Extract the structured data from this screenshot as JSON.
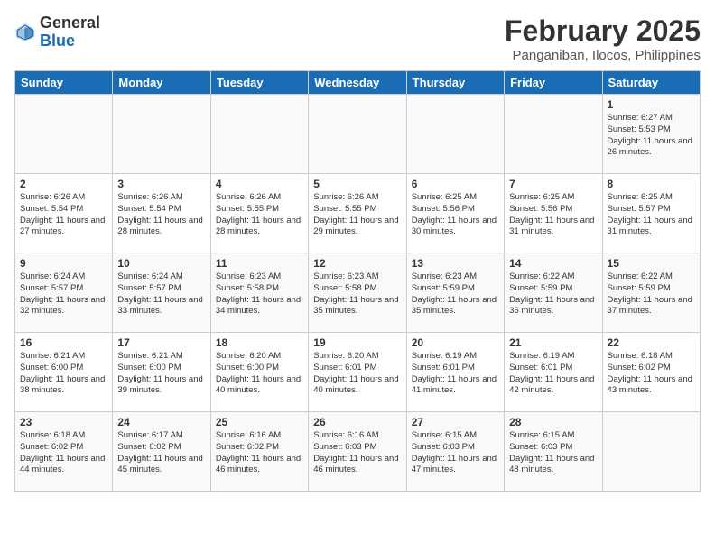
{
  "header": {
    "logo_general": "General",
    "logo_blue": "Blue",
    "month_year": "February 2025",
    "location": "Panganiban, Ilocos, Philippines"
  },
  "days_of_week": [
    "Sunday",
    "Monday",
    "Tuesday",
    "Wednesday",
    "Thursday",
    "Friday",
    "Saturday"
  ],
  "weeks": [
    [
      {
        "day": "",
        "info": ""
      },
      {
        "day": "",
        "info": ""
      },
      {
        "day": "",
        "info": ""
      },
      {
        "day": "",
        "info": ""
      },
      {
        "day": "",
        "info": ""
      },
      {
        "day": "",
        "info": ""
      },
      {
        "day": "1",
        "info": "Sunrise: 6:27 AM\nSunset: 5:53 PM\nDaylight: 11 hours and 26 minutes."
      }
    ],
    [
      {
        "day": "2",
        "info": "Sunrise: 6:26 AM\nSunset: 5:54 PM\nDaylight: 11 hours and 27 minutes."
      },
      {
        "day": "3",
        "info": "Sunrise: 6:26 AM\nSunset: 5:54 PM\nDaylight: 11 hours and 28 minutes."
      },
      {
        "day": "4",
        "info": "Sunrise: 6:26 AM\nSunset: 5:55 PM\nDaylight: 11 hours and 28 minutes."
      },
      {
        "day": "5",
        "info": "Sunrise: 6:26 AM\nSunset: 5:55 PM\nDaylight: 11 hours and 29 minutes."
      },
      {
        "day": "6",
        "info": "Sunrise: 6:25 AM\nSunset: 5:56 PM\nDaylight: 11 hours and 30 minutes."
      },
      {
        "day": "7",
        "info": "Sunrise: 6:25 AM\nSunset: 5:56 PM\nDaylight: 11 hours and 31 minutes."
      },
      {
        "day": "8",
        "info": "Sunrise: 6:25 AM\nSunset: 5:57 PM\nDaylight: 11 hours and 31 minutes."
      }
    ],
    [
      {
        "day": "9",
        "info": "Sunrise: 6:24 AM\nSunset: 5:57 PM\nDaylight: 11 hours and 32 minutes."
      },
      {
        "day": "10",
        "info": "Sunrise: 6:24 AM\nSunset: 5:57 PM\nDaylight: 11 hours and 33 minutes."
      },
      {
        "day": "11",
        "info": "Sunrise: 6:23 AM\nSunset: 5:58 PM\nDaylight: 11 hours and 34 minutes."
      },
      {
        "day": "12",
        "info": "Sunrise: 6:23 AM\nSunset: 5:58 PM\nDaylight: 11 hours and 35 minutes."
      },
      {
        "day": "13",
        "info": "Sunrise: 6:23 AM\nSunset: 5:59 PM\nDaylight: 11 hours and 35 minutes."
      },
      {
        "day": "14",
        "info": "Sunrise: 6:22 AM\nSunset: 5:59 PM\nDaylight: 11 hours and 36 minutes."
      },
      {
        "day": "15",
        "info": "Sunrise: 6:22 AM\nSunset: 5:59 PM\nDaylight: 11 hours and 37 minutes."
      }
    ],
    [
      {
        "day": "16",
        "info": "Sunrise: 6:21 AM\nSunset: 6:00 PM\nDaylight: 11 hours and 38 minutes."
      },
      {
        "day": "17",
        "info": "Sunrise: 6:21 AM\nSunset: 6:00 PM\nDaylight: 11 hours and 39 minutes."
      },
      {
        "day": "18",
        "info": "Sunrise: 6:20 AM\nSunset: 6:00 PM\nDaylight: 11 hours and 40 minutes."
      },
      {
        "day": "19",
        "info": "Sunrise: 6:20 AM\nSunset: 6:01 PM\nDaylight: 11 hours and 40 minutes."
      },
      {
        "day": "20",
        "info": "Sunrise: 6:19 AM\nSunset: 6:01 PM\nDaylight: 11 hours and 41 minutes."
      },
      {
        "day": "21",
        "info": "Sunrise: 6:19 AM\nSunset: 6:01 PM\nDaylight: 11 hours and 42 minutes."
      },
      {
        "day": "22",
        "info": "Sunrise: 6:18 AM\nSunset: 6:02 PM\nDaylight: 11 hours and 43 minutes."
      }
    ],
    [
      {
        "day": "23",
        "info": "Sunrise: 6:18 AM\nSunset: 6:02 PM\nDaylight: 11 hours and 44 minutes."
      },
      {
        "day": "24",
        "info": "Sunrise: 6:17 AM\nSunset: 6:02 PM\nDaylight: 11 hours and 45 minutes."
      },
      {
        "day": "25",
        "info": "Sunrise: 6:16 AM\nSunset: 6:02 PM\nDaylight: 11 hours and 46 minutes."
      },
      {
        "day": "26",
        "info": "Sunrise: 6:16 AM\nSunset: 6:03 PM\nDaylight: 11 hours and 46 minutes."
      },
      {
        "day": "27",
        "info": "Sunrise: 6:15 AM\nSunset: 6:03 PM\nDaylight: 11 hours and 47 minutes."
      },
      {
        "day": "28",
        "info": "Sunrise: 6:15 AM\nSunset: 6:03 PM\nDaylight: 11 hours and 48 minutes."
      },
      {
        "day": "",
        "info": ""
      }
    ]
  ]
}
